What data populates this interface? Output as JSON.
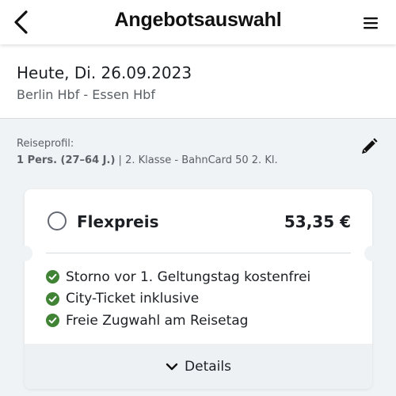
{
  "topbar": {
    "title": "Angebotsauswahl",
    "back_icon": "chevron-left-icon",
    "menu_icon": "hamburger-menu-icon"
  },
  "journey": {
    "date": "Heute, Di. 26.09.2023",
    "route": "Berlin Hbf - Essen Hbf"
  },
  "profile": {
    "label": "Reiseprofil:",
    "passengers": "1 Pers. (27–64 J.)",
    "separator": " | ",
    "details": "2. Klasse - BahnCard 50 2. Kl.",
    "edit_icon": "pencil-icon"
  },
  "offer": {
    "name": "Flexpreis",
    "price": "53,35 €",
    "features": [
      "Storno vor 1. Geltungstag kostenfrei",
      "City-Ticket inklusive",
      "Freie Zugwahl am Reisetag"
    ],
    "details_label": "Details",
    "check_color": "#408335"
  }
}
